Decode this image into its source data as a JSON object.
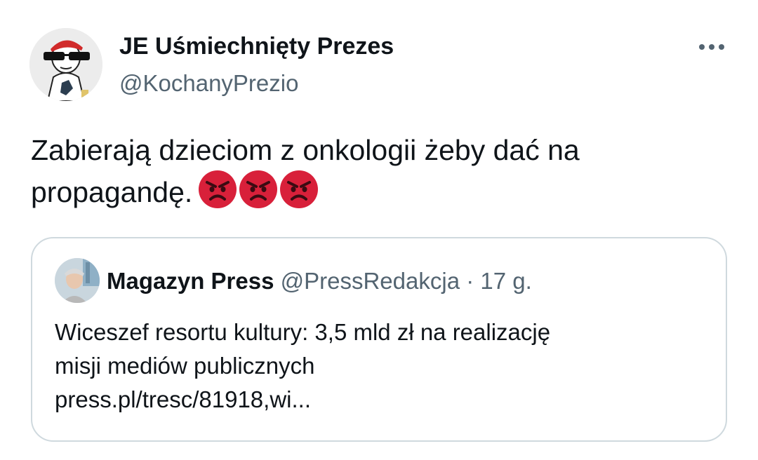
{
  "tweet": {
    "author": {
      "name": "JE Uśmiechnięty Prezes",
      "handle": "@KochanyPrezio",
      "avatar_icon": "cartoon-avatar-icon"
    },
    "text": "Zabierają dzieciom z onkologii żeby dać na propagandę.",
    "emojis": [
      "angry-face-emoji",
      "angry-face-emoji",
      "angry-face-emoji"
    ],
    "more_icon": "more-options-icon"
  },
  "quote": {
    "author": {
      "name": "Magazyn Press",
      "handle": "@PressRedakcja",
      "separator": "·",
      "time": "17 g.",
      "avatar_icon": "photo-avatar-icon"
    },
    "text_lines": [
      "Wiceszef resortu kultury: 3,5 mld zł na realizację",
      "misji mediów publicznych",
      "press.pl/tresc/81918,wi..."
    ]
  },
  "colors": {
    "text_primary": "#0f1419",
    "text_secondary": "#536471",
    "border": "#cfd9de",
    "emoji_red": "#d8203a"
  }
}
